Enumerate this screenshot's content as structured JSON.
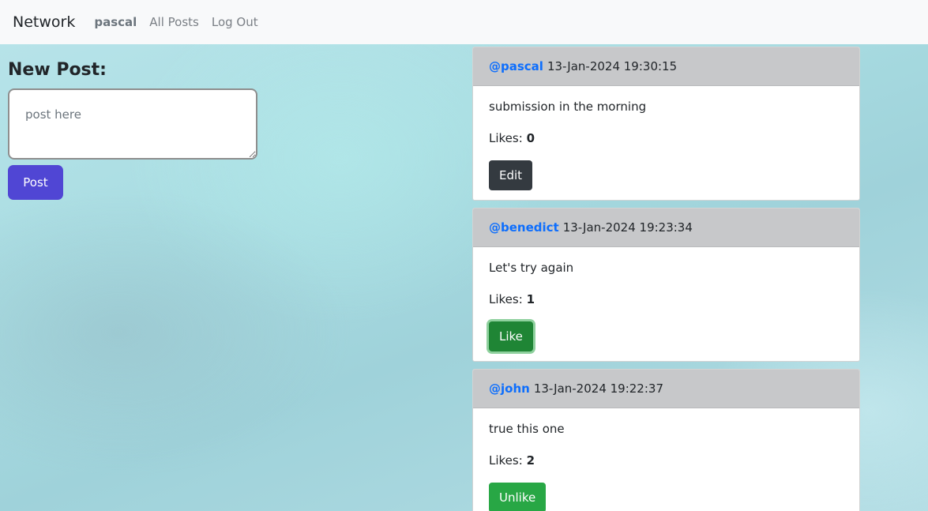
{
  "navbar": {
    "brand": "Network",
    "username": "pascal",
    "all_posts": "All Posts",
    "log_out": "Log Out"
  },
  "new_post": {
    "title": "New Post:",
    "placeholder": "post here",
    "button": "Post"
  },
  "likes_label": "Likes:",
  "posts": [
    {
      "author": "@pascal",
      "timestamp": "13-Jan-2024 19:30:15",
      "content": "submission in the morning",
      "likes": "0",
      "action": "Edit"
    },
    {
      "author": "@benedict",
      "timestamp": "13-Jan-2024 19:23:34",
      "content": "Let's try again",
      "likes": "1",
      "action": "Like"
    },
    {
      "author": "@john",
      "timestamp": "13-Jan-2024 19:22:37",
      "content": "true this one",
      "likes": "2",
      "action": "Unlike"
    }
  ],
  "colors": {
    "navbar_bg": "#f8f9fa",
    "post_button": "#5046d4",
    "edit_button": "#343a40",
    "like_button": "#1f8535",
    "unlike_button": "#28a745",
    "author_link": "#0d6efd",
    "card_header": "#c7c8ca"
  }
}
